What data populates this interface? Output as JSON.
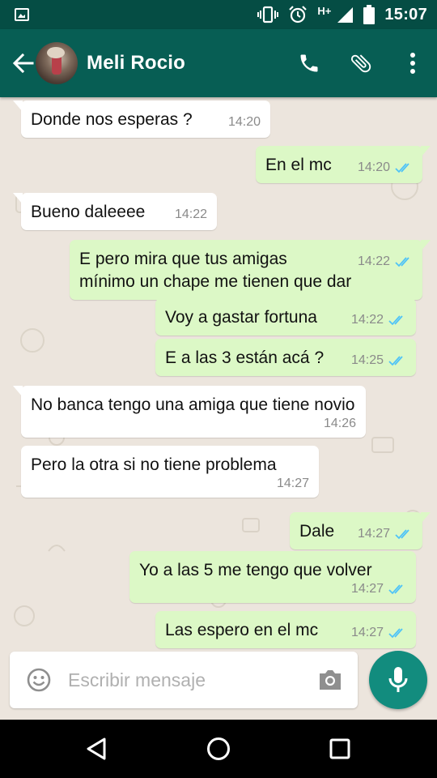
{
  "status_bar": {
    "time": "15:07",
    "network": "H+",
    "icons": [
      "image-icon",
      "vibrate-icon",
      "alarm-icon",
      "signal-icon",
      "battery-icon"
    ]
  },
  "header": {
    "contact_name": "Meli Rocio",
    "actions": [
      "phone-icon",
      "attach-icon",
      "more-icon"
    ]
  },
  "colors": {
    "header": "#075e54",
    "status_bar": "#054d44",
    "outgoing_bubble": "#dcf8c6",
    "incoming_bubble": "#ffffff",
    "chat_background": "#ece5dd",
    "read_ticks": "#4fc3f7",
    "mic_button": "#128c7e"
  },
  "messages": [
    {
      "dir": "in",
      "text": "Donde nos esperas ?",
      "time": "14:20"
    },
    {
      "dir": "out",
      "text": "En el mc",
      "time": "14:20",
      "status": "read"
    },
    {
      "dir": "in",
      "text": "Bueno daleeee",
      "time": "14:22"
    },
    {
      "dir": "out",
      "text": "E pero mira que tus amigas mínimo un chape me tienen que dar",
      "time": "14:22",
      "status": "read"
    },
    {
      "dir": "out",
      "text": "Voy a gastar fortuna",
      "time": "14:22",
      "status": "read"
    },
    {
      "dir": "out",
      "text": "E a las 3 están acá ?",
      "time": "14:25",
      "status": "read"
    },
    {
      "dir": "in",
      "text": "No banca tengo una amiga que tiene novio",
      "time": "14:26"
    },
    {
      "dir": "in",
      "text": "Pero la otra si no tiene problema",
      "time": "14:27"
    },
    {
      "dir": "out",
      "text": "Dale",
      "time": "14:27",
      "status": "read"
    },
    {
      "dir": "out",
      "text": "Yo a las 5 me tengo que volver",
      "time": "14:27",
      "status": "read"
    },
    {
      "dir": "out",
      "text": "Las espero en el mc",
      "time": "14:27",
      "status": "read"
    }
  ],
  "composer": {
    "placeholder": "Escribir mensaje",
    "value": ""
  }
}
